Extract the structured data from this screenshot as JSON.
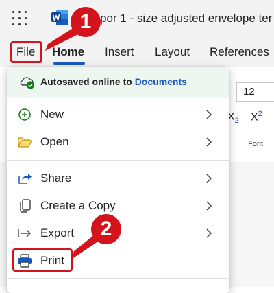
{
  "app": {
    "title": "por 1 - size adjusted envelope ter",
    "logo": "word-logo"
  },
  "tabs": [
    {
      "label": "File"
    },
    {
      "label": "Home"
    },
    {
      "label": "Insert"
    },
    {
      "label": "Layout"
    },
    {
      "label": "References"
    }
  ],
  "ribbon": {
    "font_size": "12",
    "subscript_label": "X",
    "subscript_mark": "2",
    "superscript_label": "X",
    "superscript_mark": "2",
    "font_group": "Font"
  },
  "file_menu": {
    "autosave_text": "Autosaved online to ",
    "autosave_link": "Documents",
    "items": [
      {
        "label": "New",
        "icon": "plus-circle-icon",
        "has_submenu": true
      },
      {
        "label": "Open",
        "icon": "folder-open-icon",
        "has_submenu": true
      },
      {
        "label": "Share",
        "icon": "share-icon",
        "has_submenu": true
      },
      {
        "label": "Create a Copy",
        "icon": "copy-icon",
        "has_submenu": true
      },
      {
        "label": "Export",
        "icon": "export-icon",
        "has_submenu": true
      },
      {
        "label": "Print",
        "icon": "printer-icon",
        "has_submenu": false
      }
    ]
  },
  "annotations": {
    "step1": "1",
    "step2": "2"
  },
  "colors": {
    "accent": "#185abd",
    "annotation_red": "#d4141c",
    "autosave_bg": "#eef6f0",
    "check_green": "#107c10"
  }
}
